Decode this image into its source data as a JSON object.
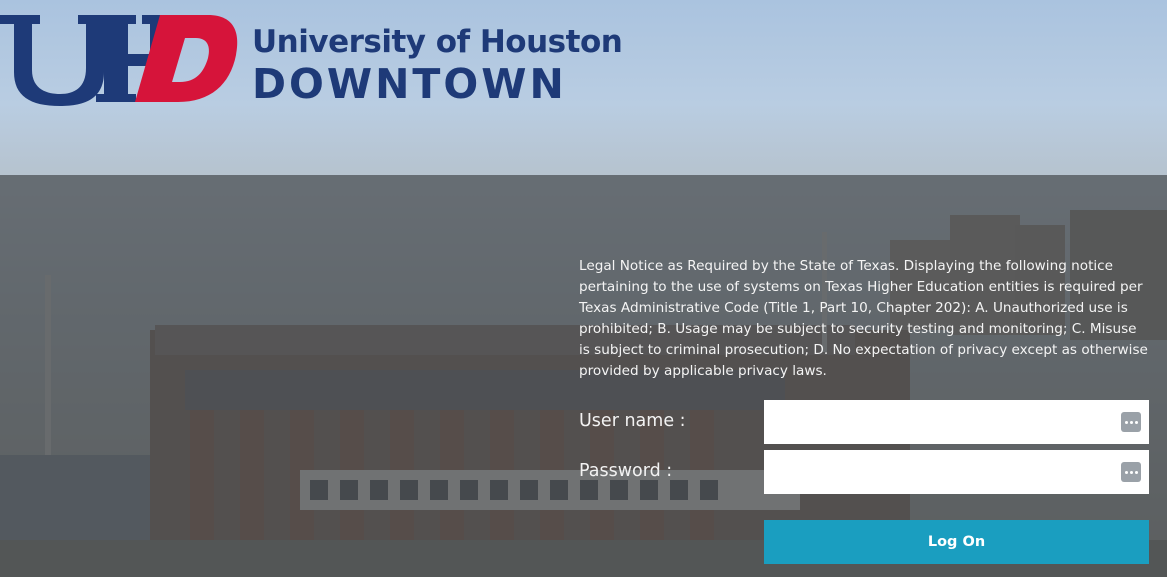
{
  "brand": {
    "mark_text": "UHD",
    "name_line1": "University of Houston",
    "name_line2": "DOWNTOWN",
    "colors": {
      "navy": "#1e3a78",
      "red": "#d6143a"
    }
  },
  "legal_notice": "Legal Notice as Required by the State of Texas. Displaying the following notice pertaining to the use of systems on Texas Higher Education entities is required per Texas Administrative Code (Title 1, Part 10, Chapter 202): A. Unauthorized use is prohibited; B. Usage may be subject to security testing and monitoring; C. Misuse is subject to criminal prosecution; D. No expectation of privacy except as otherwise provided by applicable privacy laws.",
  "form": {
    "username_label": "User name :",
    "username_value": "",
    "password_label": "Password :",
    "password_value": "",
    "field_icon": "password-manager-icon",
    "submit_label": "Log On"
  },
  "theme": {
    "button_color": "#1a9ec0"
  }
}
